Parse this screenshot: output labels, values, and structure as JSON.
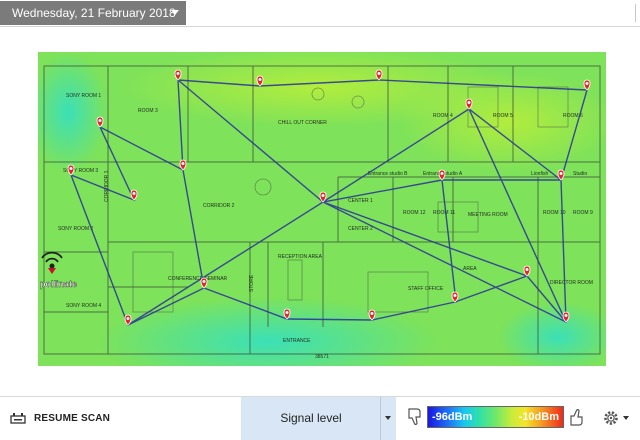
{
  "header": {
    "date_label": "Wednesday, 21 February 2018"
  },
  "map": {
    "brand_label": "pollinate",
    "room_labels": [
      "SONY ROOM 1",
      "ROOM 3",
      "CHILL OUT CORNER",
      "ROOM 4",
      "ROOM 5",
      "ROOM 6",
      "SONY ROOM 2",
      "CORRIDOR 1",
      "CORRIDOR 2",
      "CENTER 1",
      "CENTER 2",
      "ROOM 12",
      "ROOM 11",
      "MEETING ROOM",
      "ROOM 10",
      "ROOM 9",
      "Lionfish",
      "Studio",
      "Entrance studio B",
      "Entrance studio A",
      "SONY ROOM 3",
      "SONY ROOM 4",
      "CONFERENCE SEMINAR",
      "STORE",
      "RECEPTION AREA",
      "STAFF OFFICE",
      "ENTRANCE",
      "DIRECTOR ROOM",
      "AREA"
    ],
    "dimension_label": "38571"
  },
  "bottom_bar": {
    "resume_label": "RESUME SCAN",
    "signal_select_label": "Signal level",
    "legend_min": "-96dBm",
    "legend_max": "-10dBm"
  },
  "colors": {
    "accent_select": "#d9e6f5",
    "pin": "#e8222a",
    "path": "#2a2f9a",
    "heat_mid": "#7ee25a"
  },
  "icons": {
    "resume": "scan-icon",
    "thumb_down": "thumbs-down-icon",
    "thumb_up": "thumbs-up-icon",
    "settings": "settings-gear-icon",
    "wifi": "wifi-signal-icon",
    "pin": "map-pin-icon"
  }
}
